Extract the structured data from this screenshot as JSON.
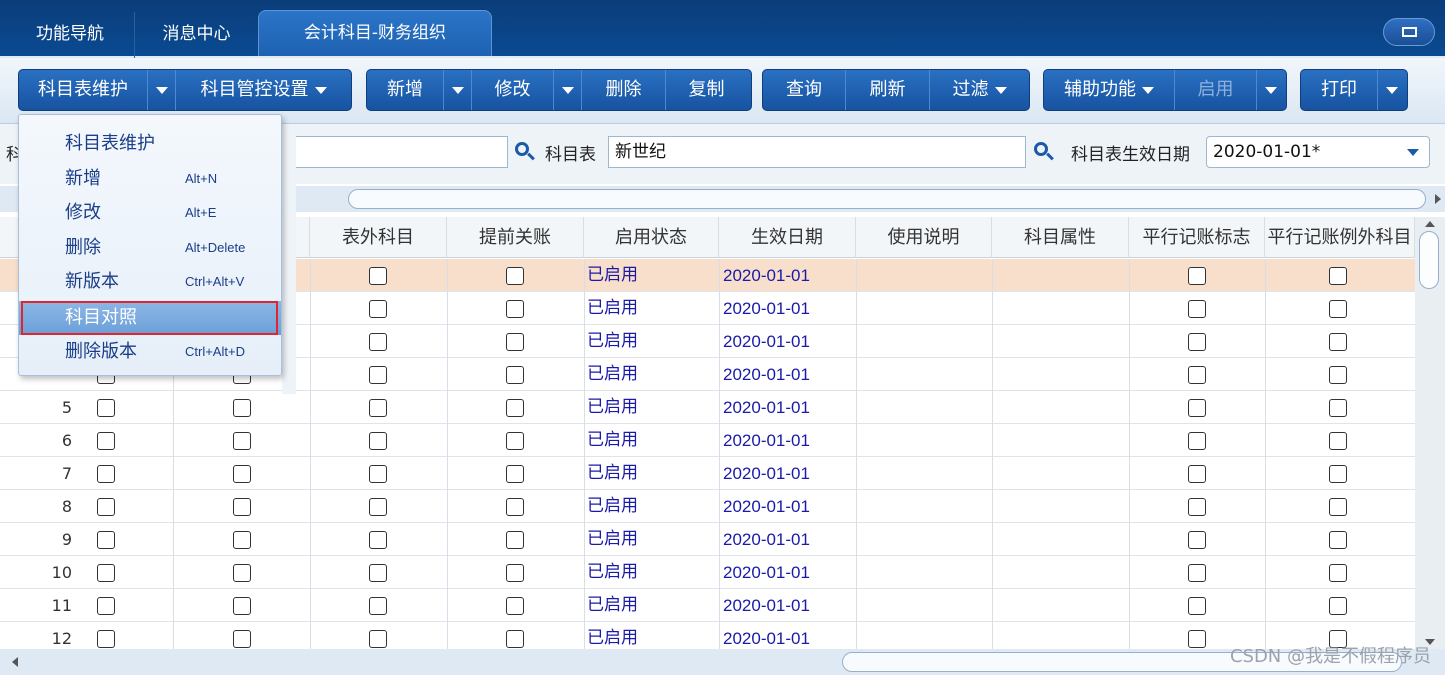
{
  "tabs": [
    {
      "label": "功能导航"
    },
    {
      "label": "消息中心"
    },
    {
      "label": "会计科目-财务组织"
    }
  ],
  "toolbar": {
    "account_table_maint": "科目表维护",
    "control_settings": "科目管控设置",
    "add": "新增",
    "modify": "修改",
    "delete": "删除",
    "copy": "复制",
    "query": "查询",
    "refresh": "刷新",
    "filter": "过滤",
    "aux": "辅助功能",
    "enable": "启用",
    "print": "打印"
  },
  "filter": {
    "table_label": "科目表",
    "table_value": "新世纪",
    "date_label": "科目表生效日期",
    "date_value": "2020-01-01*",
    "left_label_partial": "科"
  },
  "columns": [
    "表外科目",
    "提前关账",
    "启用状态",
    "生效日期",
    "使用说明",
    "科目属性",
    "平行记账标志",
    "平行记账例外科目"
  ],
  "rows": [
    {
      "num": "",
      "status": "已启用",
      "date": "2020-01-01"
    },
    {
      "num": "",
      "status": "已启用",
      "date": "2020-01-01"
    },
    {
      "num": "",
      "status": "已启用",
      "date": "2020-01-01"
    },
    {
      "num": "",
      "status": "已启用",
      "date": "2020-01-01"
    },
    {
      "num": "5",
      "status": "已启用",
      "date": "2020-01-01"
    },
    {
      "num": "6",
      "status": "已启用",
      "date": "2020-01-01"
    },
    {
      "num": "7",
      "status": "已启用",
      "date": "2020-01-01"
    },
    {
      "num": "8",
      "status": "已启用",
      "date": "2020-01-01"
    },
    {
      "num": "9",
      "status": "已启用",
      "date": "2020-01-01"
    },
    {
      "num": "10",
      "status": "已启用",
      "date": "2020-01-01"
    },
    {
      "num": "11",
      "status": "已启用",
      "date": "2020-01-01"
    },
    {
      "num": "12",
      "status": "已启用",
      "date": "2020-01-01"
    }
  ],
  "menu": {
    "items": [
      {
        "label": "科目表维护",
        "shortcut": ""
      },
      {
        "label": "新增",
        "shortcut": "Alt+N"
      },
      {
        "label": "修改",
        "shortcut": "Alt+E"
      },
      {
        "label": "删除",
        "shortcut": "Alt+Delete"
      },
      {
        "label": "新版本",
        "shortcut": "Ctrl+Alt+V"
      },
      {
        "label": "科目对照",
        "shortcut": ""
      },
      {
        "label": "删除版本",
        "shortcut": "Ctrl+Alt+D"
      }
    ]
  },
  "watermark": "CSDN @我是不假程序员",
  "colors": {
    "accent": "#1753a1",
    "selected_row": "#f8dfcb",
    "status_text": "#1a1aa8",
    "highlight_border": "#e0262c"
  }
}
